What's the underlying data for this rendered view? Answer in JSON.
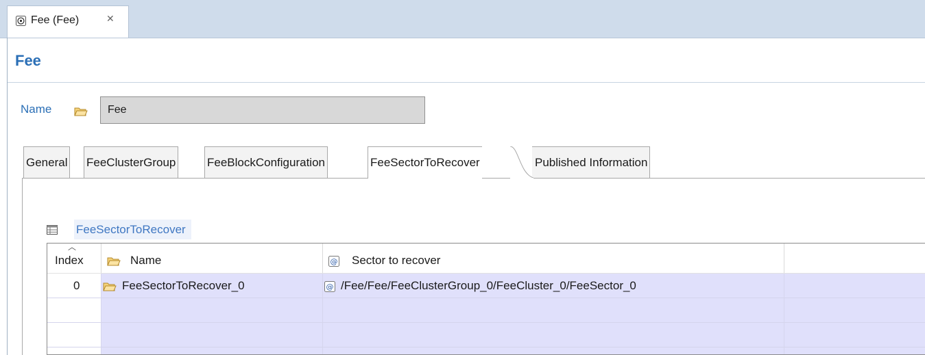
{
  "editor_tab": {
    "title": "Fee (Fee)",
    "close_glyph": "✕"
  },
  "page_title": "Fee",
  "name_field": {
    "label": "Name",
    "value": "Fee"
  },
  "tabs": [
    {
      "label": "General"
    },
    {
      "label": "FeeClusterGroup"
    },
    {
      "label": "FeeBlockConfiguration"
    },
    {
      "label": "FeeSectorToRecover",
      "active": true
    },
    {
      "label": "Published Information"
    }
  ],
  "section": {
    "title": "FeeSectorToRecover"
  },
  "table": {
    "columns": {
      "index": "Index",
      "name": "Name",
      "sector": "Sector to recover"
    },
    "rows": [
      {
        "index": "0",
        "name": "FeeSectorToRecover_0",
        "sector": "/Fee/Fee/FeeClusterGroup_0/FeeCluster_0/FeeSector_0"
      }
    ]
  },
  "colors": {
    "title_blue": "#2b6fb6",
    "row_highlight": "#e0e0fb",
    "tabstrip": "#cfdceb"
  }
}
